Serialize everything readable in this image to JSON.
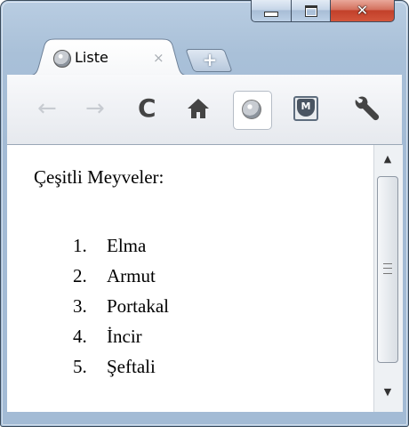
{
  "window": {
    "minimize_icon": "minimize-icon",
    "maximize_icon": "maximize-icon",
    "close_icon": "close-icon",
    "close_glyph": "✕"
  },
  "tab": {
    "title": "Liste",
    "close_glyph": "×",
    "favicon": "globe-icon"
  },
  "new_tab": {
    "glyph": "+"
  },
  "toolbar": {
    "back_glyph": "←",
    "forward_glyph": "→",
    "reload_glyph": "C",
    "home_glyph": "⌂",
    "extension_label": "M",
    "wrench_glyph": "🔧"
  },
  "page": {
    "heading": "Çeşitli Meyveler:",
    "items": [
      {
        "num": "1.",
        "name": "Elma"
      },
      {
        "num": "2.",
        "name": "Armut"
      },
      {
        "num": "3.",
        "name": "Portakal"
      },
      {
        "num": "4.",
        "name": "İncir"
      },
      {
        "num": "5.",
        "name": "Şeftali"
      }
    ]
  },
  "scrollbar": {
    "up_glyph": "▲",
    "down_glyph": "▼"
  }
}
